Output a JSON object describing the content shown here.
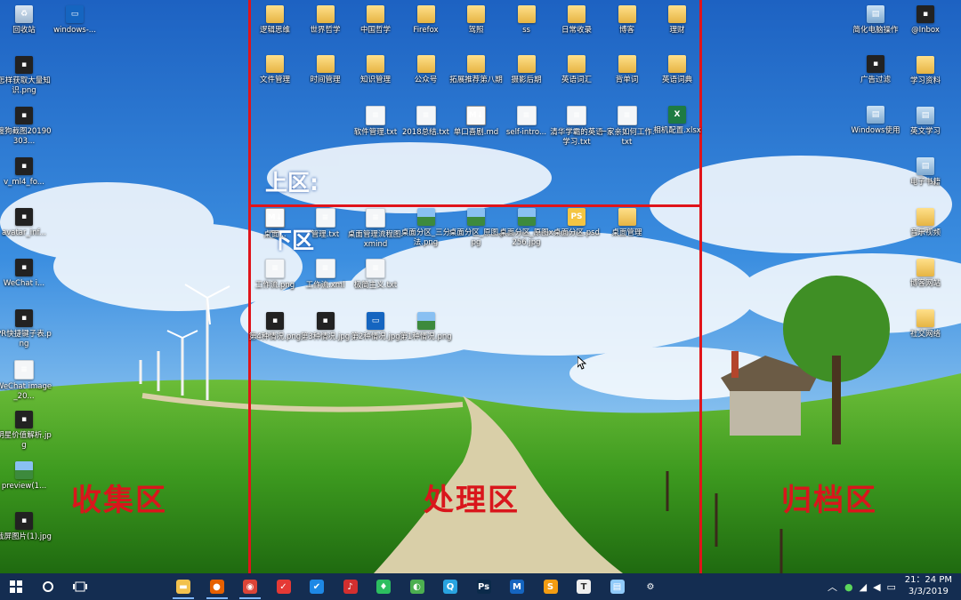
{
  "desktop": {
    "left_icons": [
      {
        "label": "回收站",
        "icon": "recycle-bin-icon",
        "kind": "bin"
      },
      {
        "label": "windows-...",
        "icon": "windows-shortcut-icon",
        "kind": "win"
      },
      {
        "label": "怎样获取大量知识.png",
        "icon": "image-file-icon",
        "kind": "dark"
      },
      {
        "label": "搜狗截图20190303...",
        "icon": "image-file-icon",
        "kind": "dark"
      },
      {
        "label": "v_ml4_fo...",
        "icon": "image-file-icon",
        "kind": "dark"
      },
      {
        "label": "avatar_inf...",
        "icon": "image-file-icon",
        "kind": "dark"
      },
      {
        "label": "WeChat i...",
        "icon": "image-file-icon",
        "kind": "dark"
      },
      {
        "label": "PR快捷键子表.png",
        "icon": "image-file-icon",
        "kind": "dark"
      },
      {
        "label": "WeChat image_20...",
        "icon": "image-file-icon",
        "kind": "doc"
      },
      {
        "label": "明星价值解析.jpg",
        "icon": "image-file-icon",
        "kind": "dark"
      },
      {
        "label": "preview(1...",
        "icon": "image-file-icon",
        "kind": "img"
      },
      {
        "label": "截屏图片(1).jpg",
        "icon": "image-file-icon",
        "kind": "dark"
      }
    ],
    "upper_row1": [
      {
        "label": "逻辑思维",
        "icon": "folder-icon",
        "kind": "folder"
      },
      {
        "label": "世界哲学",
        "icon": "folder-icon",
        "kind": "folder"
      },
      {
        "label": "中国哲学",
        "icon": "folder-icon",
        "kind": "folder"
      },
      {
        "label": "Firefox",
        "icon": "folder-icon",
        "kind": "folder"
      },
      {
        "label": "驾照",
        "icon": "folder-icon",
        "kind": "folder"
      },
      {
        "label": "ss",
        "icon": "folder-icon",
        "kind": "folder"
      },
      {
        "label": "日常收录",
        "icon": "folder-icon",
        "kind": "folder"
      },
      {
        "label": "博客",
        "icon": "folder-icon",
        "kind": "folder"
      },
      {
        "label": "理财",
        "icon": "folder-icon",
        "kind": "folder"
      }
    ],
    "upper_row2": [
      {
        "label": "文件管理",
        "icon": "folder-icon",
        "kind": "folder"
      },
      {
        "label": "时间管理",
        "icon": "folder-icon",
        "kind": "folder"
      },
      {
        "label": "知识管理",
        "icon": "folder-icon",
        "kind": "folder"
      },
      {
        "label": "公众号",
        "icon": "folder-icon",
        "kind": "folder"
      },
      {
        "label": "拓展推荐第八期",
        "icon": "folder-icon",
        "kind": "folder"
      },
      {
        "label": "摄影后期",
        "icon": "folder-icon",
        "kind": "folder"
      },
      {
        "label": "英语词汇",
        "icon": "folder-icon",
        "kind": "folder"
      },
      {
        "label": "背单词",
        "icon": "folder-icon",
        "kind": "folder"
      },
      {
        "label": "英语词典",
        "icon": "folder-icon",
        "kind": "folder"
      }
    ],
    "upper_row3": [
      {
        "label": "软件管理.txt",
        "icon": "text-file-icon",
        "kind": "doc"
      },
      {
        "label": "2018总结.txt",
        "icon": "text-file-icon",
        "kind": "doc"
      },
      {
        "label": "单口喜剧.md",
        "icon": "markdown-file-icon",
        "kind": "md"
      },
      {
        "label": "self-intro...",
        "icon": "text-file-icon",
        "kind": "doc"
      },
      {
        "label": "清华学霸的英语学习.txt",
        "icon": "text-file-icon",
        "kind": "doc"
      },
      {
        "label": "一家亲如何工作.txt",
        "icon": "text-file-icon",
        "kind": "doc"
      },
      {
        "label": "相机配置.xlsx",
        "icon": "excel-file-icon",
        "kind": "xls"
      }
    ],
    "lower_row1": [
      {
        "label": "桌面...",
        "icon": "markdown-file-icon",
        "kind": "md"
      },
      {
        "label": "管理.txt",
        "icon": "text-file-icon",
        "kind": "doc"
      },
      {
        "label": "桌面管理流程图.xmind",
        "icon": "text-file-icon",
        "kind": "doc"
      },
      {
        "label": "桌面分区_三分法.png",
        "icon": "image-file-icon",
        "kind": "img"
      },
      {
        "label": "桌面分区_原图.jpg",
        "icon": "image-file-icon",
        "kind": "img"
      },
      {
        "label": "桌面分区_原图x256.jpg",
        "icon": "image-file-icon",
        "kind": "img"
      },
      {
        "label": "桌面分区.psd",
        "icon": "psd-file-icon",
        "kind": "psd"
      },
      {
        "label": "桌面管理",
        "icon": "folder-icon",
        "kind": "folder"
      }
    ],
    "lower_row2": [
      {
        "label": "工作流.png",
        "icon": "image-file-icon",
        "kind": "doc"
      },
      {
        "label": "工作流.xml",
        "icon": "text-file-icon",
        "kind": "doc"
      },
      {
        "label": "极简主义.txt",
        "icon": "text-file-icon",
        "kind": "doc"
      }
    ],
    "lower_row3": [
      {
        "label": "第4种情况.png",
        "icon": "image-file-icon",
        "kind": "dark"
      },
      {
        "label": "第3种情况.jpg",
        "icon": "image-file-icon",
        "kind": "dark"
      },
      {
        "label": "第2种情况.jpg",
        "icon": "image-file-icon",
        "kind": "win"
      },
      {
        "label": "第1种情况.png",
        "icon": "image-file-icon",
        "kind": "img"
      }
    ],
    "right_col1": [
      {
        "label": "简化电脑操作",
        "icon": "folder-icon",
        "kind": "pc"
      },
      {
        "label": "广告过滤",
        "icon": "folder-icon",
        "kind": "dark"
      },
      {
        "label": "Windows使用",
        "icon": "folder-icon",
        "kind": "pc"
      }
    ],
    "right_col2": [
      {
        "label": "@Inbox",
        "icon": "folder-icon",
        "kind": "dark"
      },
      {
        "label": "学习资料",
        "icon": "folder-icon",
        "kind": "folder"
      },
      {
        "label": "英文学习",
        "icon": "folder-icon",
        "kind": "pc"
      },
      {
        "label": "电子书籍",
        "icon": "folder-icon",
        "kind": "pc"
      },
      {
        "label": "音乐视频",
        "icon": "folder-icon",
        "kind": "folder"
      },
      {
        "label": "博客网站",
        "icon": "folder-icon",
        "kind": "folder"
      },
      {
        "label": "社交网络",
        "icon": "folder-icon",
        "kind": "folder"
      }
    ]
  },
  "zones": {
    "collect": "收集区",
    "process": "处理区",
    "archive": "归档区",
    "upper": "上区:",
    "lower": "下区"
  },
  "colors": {
    "zone_line": "#e0141a",
    "zone_text": "#d9161c",
    "taskbar": "#122848"
  },
  "taskbar": {
    "start_icon": "windows-start-icon",
    "search_icon": "cortana-circle-icon",
    "taskview_icon": "task-view-icon",
    "apps": [
      {
        "name": "file-explorer-icon",
        "color": "#f2c14e",
        "glyph": "▬"
      },
      {
        "name": "firefox-icon",
        "color": "#e66000",
        "glyph": "●"
      },
      {
        "name": "chrome-icon",
        "color": "#db4437",
        "glyph": "◉"
      },
      {
        "name": "todo-check-icon",
        "color": "#e53935",
        "glyph": "✓"
      },
      {
        "name": "wunderlist-check-icon",
        "color": "#1e88e5",
        "glyph": "✔"
      },
      {
        "name": "netease-music-icon",
        "color": "#d32f2f",
        "glyph": "♪"
      },
      {
        "name": "evernote-icon",
        "color": "#2dbe60",
        "glyph": "♦"
      },
      {
        "name": "wechat-icon",
        "color": "#4caf50",
        "glyph": "◐"
      },
      {
        "name": "qq-browser-icon",
        "color": "#29a3e0",
        "glyph": "Q"
      },
      {
        "name": "photoshop-icon",
        "color": "#0b2a4a",
        "glyph": "Ps"
      },
      {
        "name": "mindmanager-icon",
        "color": "#1565c0",
        "glyph": "M"
      },
      {
        "name": "sublime-text-icon",
        "color": "#f39c12",
        "glyph": "S"
      },
      {
        "name": "typora-icon",
        "color": "#eeeeee",
        "glyph": "T"
      },
      {
        "name": "notepad-icon",
        "color": "#90caf9",
        "glyph": "▤"
      },
      {
        "name": "settings-gear-icon",
        "color": "transparent",
        "glyph": "⚙"
      }
    ]
  },
  "tray": {
    "time": "21：24 PM",
    "date": "3/3/2019",
    "chevron_icon": "chevron-up-icon",
    "icons": [
      "network-icon",
      "wifi-icon",
      "volume-icon",
      "notification-icon"
    ]
  }
}
